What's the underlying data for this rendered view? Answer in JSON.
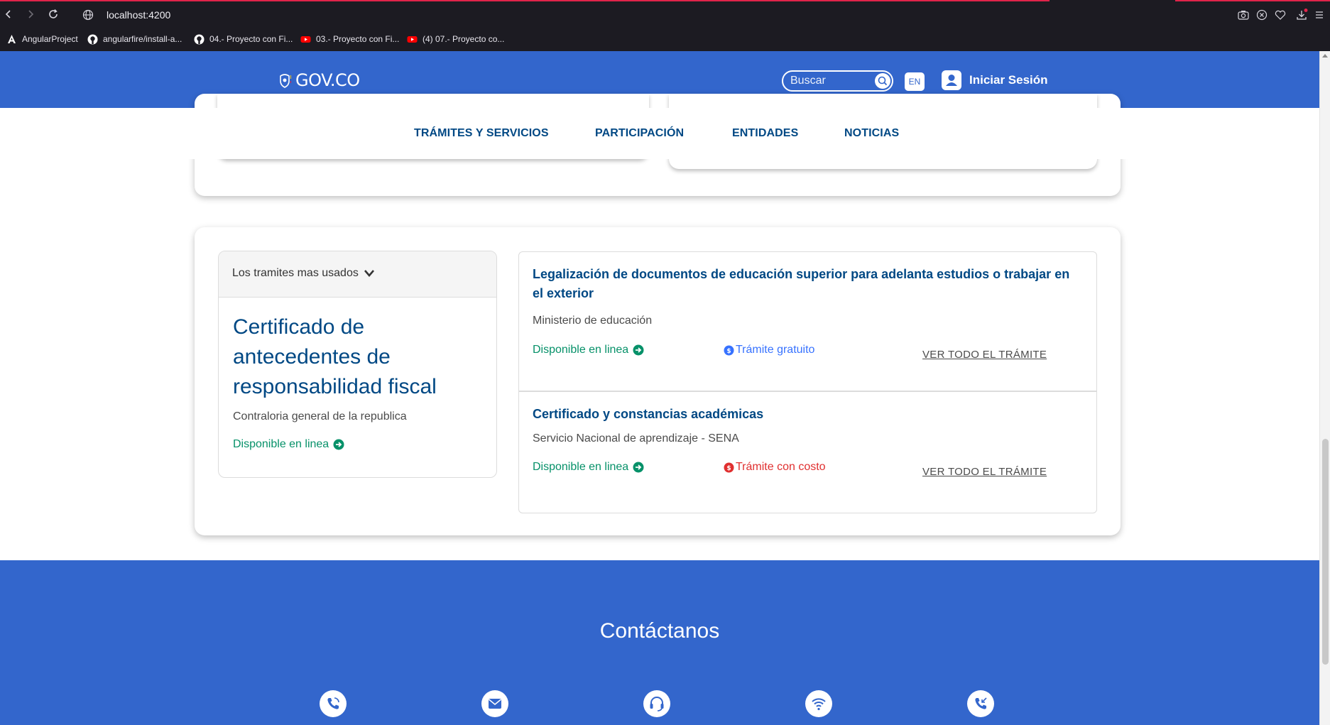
{
  "browser": {
    "url": "localhost:4200",
    "bookmarks": [
      {
        "icon": "angular-icon",
        "label": "AngularProject"
      },
      {
        "icon": "github-icon",
        "label": "angularfire/install-a..."
      },
      {
        "icon": "github-icon",
        "label": "04.- Proyecto con Fi..."
      },
      {
        "icon": "youtube-icon",
        "label": "03.- Proyecto con Fi..."
      },
      {
        "icon": "youtube-icon",
        "label": "(4) 07.- Proyecto co..."
      }
    ]
  },
  "header": {
    "logo_text": "GOV.CO",
    "search_placeholder": "Buscar",
    "lang_label": "EN",
    "login_label": "Iniciar Sesión",
    "brand_color": "#3366cc"
  },
  "nav": {
    "items": [
      "TRÁMITES Y SERVICIOS",
      "PARTICIPACIÓN",
      "ENTIDADES",
      "NOTICIAS"
    ]
  },
  "featured": {
    "dropdown_label": "Los tramites mas usados",
    "title": "Certificado de antecedentes de responsabilidad fiscal",
    "entity": "Contraloria general de la republica",
    "availability": "Disponible en linea"
  },
  "procedures": [
    {
      "title": "Legalización de documentos de educación superior para adelanta estudios o trabajar en el exterior",
      "entity": "Ministerio de educación",
      "availability": "Disponible en linea",
      "cost_label": "Trámite gratuito",
      "cost_color": "#3772ff",
      "link_label": "VER TODO EL TRÁMITE"
    },
    {
      "title": "Certificado y constancias académicas",
      "entity": "Servicio Nacional de aprendizaje - SENA",
      "availability": "Disponible en linea",
      "cost_label": "Trámite con costo",
      "cost_color": "#e02f2f",
      "link_label": "VER TODO EL TRÁMITE"
    }
  ],
  "contact": {
    "title": "Contáctanos",
    "icons": [
      "phone-icon",
      "mail-icon",
      "headset-icon",
      "wifi-icon",
      "phone-incoming-icon"
    ]
  }
}
